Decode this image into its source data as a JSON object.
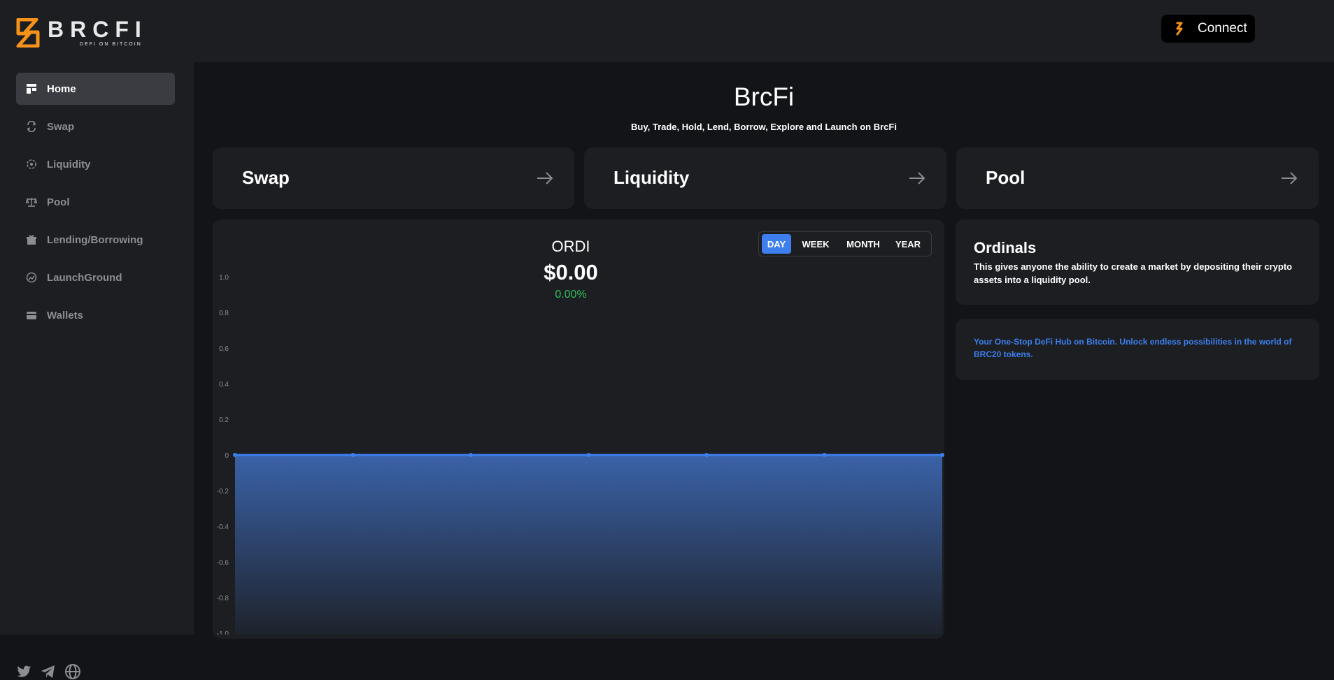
{
  "brand": {
    "name": "BRCFI",
    "tagline": "DEFI ON BITCOIN",
    "accent_color": "#f7931a"
  },
  "header": {
    "connect_label": "Connect",
    "connect_icon": "wallet-link-icon"
  },
  "sidebar": {
    "items": [
      {
        "label": "Home",
        "icon": "dashboard-icon",
        "active": true
      },
      {
        "label": "Swap",
        "icon": "swap-icon",
        "active": false
      },
      {
        "label": "Liquidity",
        "icon": "liquidity-icon",
        "active": false
      },
      {
        "label": "Pool",
        "icon": "scale-icon",
        "active": false
      },
      {
        "label": "Lending/Borrowing",
        "icon": "gift-icon",
        "active": false
      },
      {
        "label": "LaunchGround",
        "icon": "rocket-icon",
        "active": false
      },
      {
        "label": "Wallets",
        "icon": "wallet-icon",
        "active": false
      }
    ],
    "social": [
      "twitter-icon",
      "telegram-icon",
      "globe-icon"
    ]
  },
  "main": {
    "title": "BrcFi",
    "subtitle": "Buy, Trade, Hold, Lend, Borrow, Explore and Launch on BrcFi",
    "nav_cards": [
      {
        "label": "Swap"
      },
      {
        "label": "Liquidity"
      },
      {
        "label": "Pool"
      }
    ]
  },
  "chart_panel": {
    "token": "ORDI",
    "price": "$0.00",
    "change": "0.00%",
    "change_color": "#2fbf59",
    "timeframes": [
      "DAY",
      "WEEK",
      "MONTH",
      "YEAR"
    ],
    "active_timeframe": "DAY"
  },
  "info": {
    "ordinals_title": "Ordinals",
    "ordinals_text": "This gives anyone the ability to create a market by depositing their crypto assets into a liquidity pool.",
    "hub_text": "Your One-Stop DeFi Hub on Bitcoin. Unlock endless possibilities in the world of BRC20 tokens.",
    "hub_color": "#3d7fee"
  },
  "chart_data": {
    "type": "area",
    "title": "",
    "xlabel": "",
    "ylabel": "",
    "x": [
      1,
      2,
      3,
      4,
      5,
      6,
      7
    ],
    "series": [
      {
        "values": [
          0,
          0,
          0,
          0,
          0,
          0,
          0
        ],
        "color": "#3d7fee"
      }
    ],
    "yticks": [
      "1.0",
      "0.8",
      "0.6",
      "0.4",
      "0.2",
      "0",
      "-0.2",
      "-0.4",
      "-0.6",
      "-0.8",
      "-1.0"
    ],
    "ylim": [
      -1,
      1
    ],
    "grid": false,
    "legend": "none"
  }
}
